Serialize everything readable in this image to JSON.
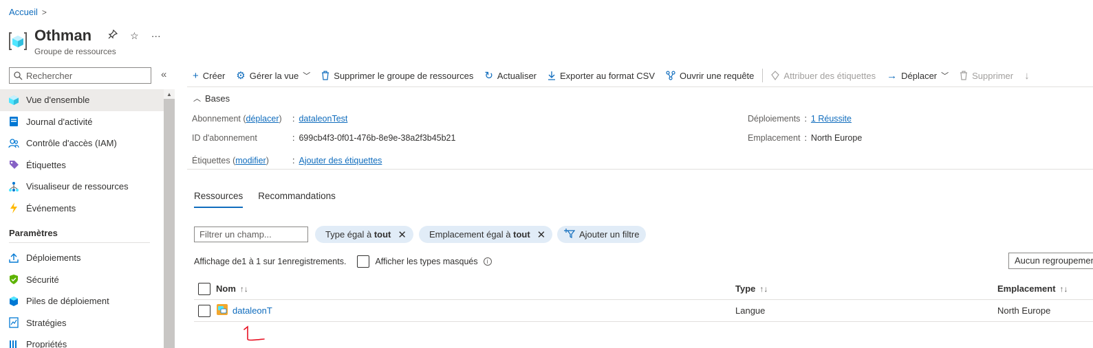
{
  "breadcrumb": {
    "home": "Accueil"
  },
  "header": {
    "title": "Othman",
    "subtitle": "Groupe de ressources",
    "more": "···"
  },
  "search": {
    "placeholder": "Rechercher"
  },
  "sidebar": {
    "items": [
      {
        "label": "Vue d'ensemble",
        "icon": "cube-icon"
      },
      {
        "label": "Journal d'activité",
        "icon": "activity-log-icon"
      },
      {
        "label": "Contrôle d'accès (IAM)",
        "icon": "people-icon"
      },
      {
        "label": "Étiquettes",
        "icon": "tag-icon"
      },
      {
        "label": "Visualiseur de ressources",
        "icon": "hierarchy-icon"
      },
      {
        "label": "Événements",
        "icon": "lightning-icon"
      }
    ],
    "section": "Paramètres",
    "settings_items": [
      {
        "label": "Déploiements",
        "icon": "upload-icon"
      },
      {
        "label": "Sécurité",
        "icon": "shield-icon"
      },
      {
        "label": "Piles de déploiement",
        "icon": "stack-icon"
      },
      {
        "label": "Stratégies",
        "icon": "policy-icon"
      },
      {
        "label": "Propriétés",
        "icon": "properties-icon"
      }
    ]
  },
  "toolbar": {
    "create": "Créer",
    "manage_view": "Gérer la vue",
    "delete_rg": "Supprimer le groupe de ressources",
    "refresh": "Actualiser",
    "export_csv": "Exporter au format CSV",
    "open_query": "Ouvrir une requête",
    "assign_tags": "Attribuer des étiquettes",
    "move": "Déplacer",
    "delete": "Supprimer"
  },
  "essentials": {
    "title": "Bases",
    "subscription_label": "Abonnement (",
    "subscription_move": "déplacer",
    "subscription_label_end": ")",
    "subscription_value": "dataleonTest",
    "subscription_id_label": "ID d'abonnement",
    "subscription_id_value": "699cb4f3-0f01-476b-8e9e-38a2f3b45b21",
    "tags_label": "Étiquettes (",
    "tags_modify": "modifier",
    "tags_label_end": ")",
    "tags_value": "Ajouter des étiquettes",
    "deployments_label": "Déploiements",
    "deployments_value": "1 Réussite",
    "location_label": "Emplacement",
    "location_value": "North Europe"
  },
  "tabs": [
    "Ressources",
    "Recommandations"
  ],
  "filters": {
    "placeholder": "Filtrer un champ...",
    "type_prefix": "Type égal à ",
    "type_value": "tout",
    "location_prefix": "Emplacement égal à ",
    "location_value": "tout",
    "add_filter": "Ajouter un filtre"
  },
  "records": {
    "prefix": "Affichage de ",
    "from": "1",
    "mid1": " à ",
    "to": "1",
    "mid2": " sur ",
    "total": "1",
    "suffix": " enregistrements.",
    "show_hidden": "Afficher les types masqués",
    "grouping": "Aucun regroupement"
  },
  "table": {
    "columns": [
      "Nom",
      "Type",
      "Emplacement"
    ],
    "rows": [
      {
        "name": "dataleonT",
        "type": "Langue",
        "location": "North Europe"
      }
    ]
  },
  "colors": {
    "accent": "#0f6cbd",
    "annotation": "#e81123"
  }
}
